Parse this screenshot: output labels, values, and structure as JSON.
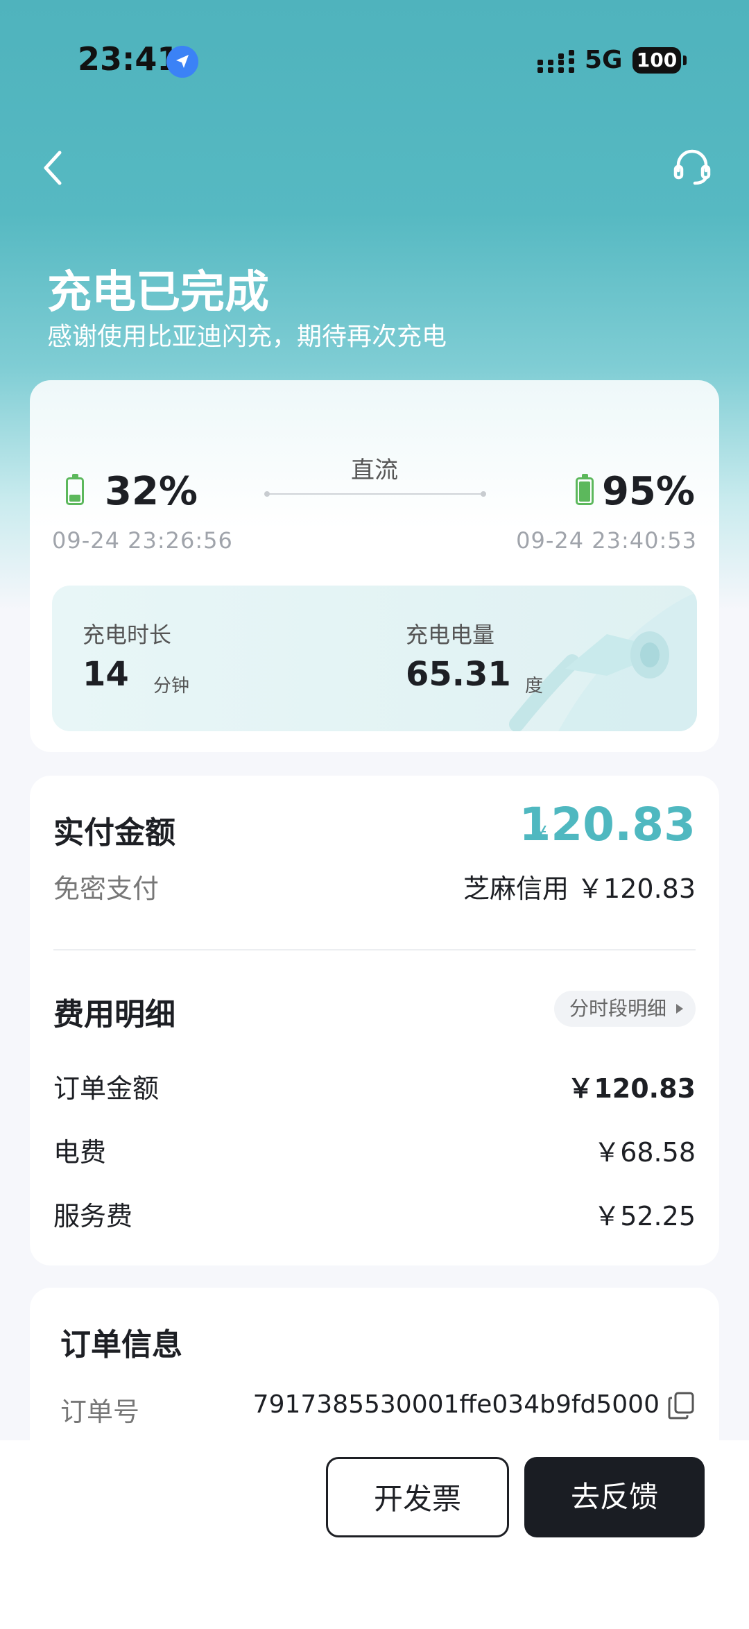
{
  "status": "ok",
  "reason": "",
  "status_bar": {
    "time": "23:41",
    "network": "5G",
    "battery": "100"
  },
  "header": {
    "title": "充电已完成",
    "subtitle": "感谢使用比亚迪闪充，期待再次充电"
  },
  "charge": {
    "mode": "直流",
    "start": {
      "percent": "32%",
      "time": "09-24 23:26:56",
      "level": 0.32
    },
    "end": {
      "percent": "95%",
      "time": "09-24 23:40:53",
      "level": 0.95
    },
    "duration_label": "充电时长",
    "duration_value": "14",
    "duration_unit": "分钟",
    "energy_label": "充电电量",
    "energy_value": "65.31",
    "energy_unit": "度"
  },
  "payment": {
    "title": "实付金额",
    "currency_symbol": "¥",
    "amount": "120.83",
    "method_label": "免密支付",
    "method_value": "芝麻信用 ￥120.83"
  },
  "fees": {
    "title": "费用明细",
    "detail_link": "分时段明细",
    "rows": [
      {
        "label": "订单金额",
        "value": "￥120.83"
      },
      {
        "label": "电费",
        "value": "￥68.58"
      },
      {
        "label": "服务费",
        "value": "￥52.25"
      }
    ]
  },
  "order": {
    "title": "订单信息",
    "number_label": "订单号",
    "number_value": "7917385530001ffe034b9fd5000"
  },
  "buttons": {
    "invoice": "开发票",
    "feedback": "去反馈"
  },
  "colors": {
    "accent": "#4fb8c0",
    "battery_green": "#5cb85c",
    "dark_button": "#1a1d23"
  }
}
